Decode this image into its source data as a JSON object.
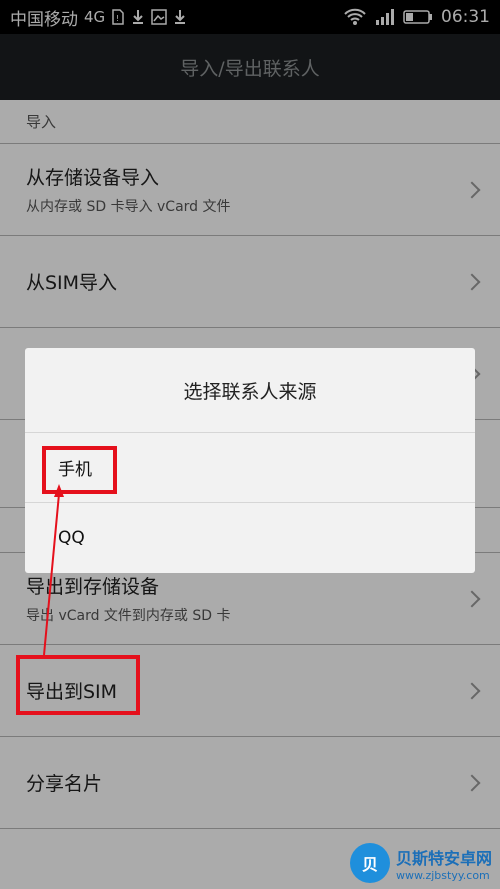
{
  "status_bar": {
    "carrier": "中国移动",
    "network": "4G",
    "time": "06:31"
  },
  "header": {
    "title": "导入/导出联系人"
  },
  "import_section": {
    "label": "导入",
    "items": [
      {
        "title": "从存储设备导入",
        "subtitle": "从内存或 SD 卡导入 vCard 文件"
      },
      {
        "title": "从SIM导入",
        "subtitle": ""
      }
    ]
  },
  "export_items": [
    {
      "title": "导出到存储设备",
      "subtitle": "导出 vCard 文件到内存或 SD 卡"
    },
    {
      "title": "导出到SIM",
      "subtitle": ""
    },
    {
      "title": "分享名片",
      "subtitle": ""
    }
  ],
  "dialog": {
    "title": "选择联系人来源",
    "options": [
      "手机",
      "QQ"
    ]
  },
  "watermark": {
    "name": "贝斯特安卓网",
    "url": "www.zjbstyy.com"
  },
  "colors": {
    "annotation_red": "#e5101c",
    "title_bar": "#1c1f21",
    "list_bg": "#ffffff"
  }
}
